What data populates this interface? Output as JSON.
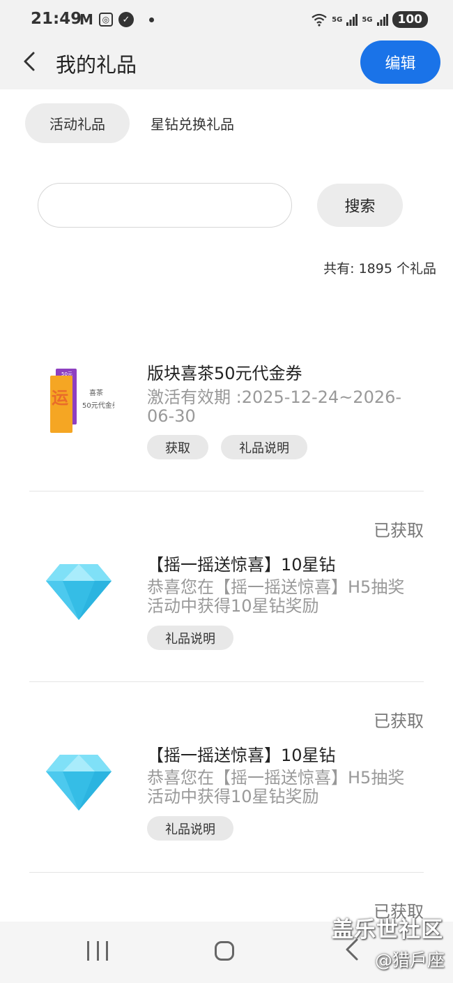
{
  "status_bar": {
    "time": "21:49",
    "battery": "100",
    "network_1": "5G",
    "network_2": "5G"
  },
  "header": {
    "title": "我的礼品",
    "edit_label": "编辑"
  },
  "tabs": [
    {
      "label": "活动礼品",
      "active": true
    },
    {
      "label": "星钻兑换礼品",
      "active": false
    }
  ],
  "search": {
    "placeholder": "",
    "button_label": "搜索"
  },
  "total_count": "共有: 1895 个礼品",
  "gifts": [
    {
      "title": "版块喜茶50元代金券",
      "description": "激活有效期 :2025-12-24~2026-06-30",
      "status": "",
      "icon": "voucher-card-icon",
      "voucher_text": "喜茶 50元代金券",
      "actions": [
        "获取",
        "礼品说明"
      ]
    },
    {
      "title": "【摇一摇送惊喜】10星钻",
      "description": "恭喜您在【摇一摇送惊喜】H5抽奖活动中获得10星钻奖励",
      "status": "已获取",
      "icon": "diamond-icon",
      "actions": [
        "礼品说明"
      ]
    },
    {
      "title": "【摇一摇送惊喜】10星钻",
      "description": "恭喜您在【摇一摇送惊喜】H5抽奖活动中获得10星钻奖励",
      "status": "已获取",
      "icon": "diamond-icon",
      "actions": [
        "礼品说明"
      ]
    },
    {
      "status": "已获取"
    }
  ],
  "watermark": {
    "line1": "盖乐世社区",
    "line2": "@猎戶座"
  },
  "colors": {
    "accent": "#1a73e8",
    "diamond_light": "#7fe0f7",
    "diamond_dark": "#2bb4e0",
    "voucher_orange": "#f5a623",
    "voucher_purple": "#8e3fc0"
  }
}
